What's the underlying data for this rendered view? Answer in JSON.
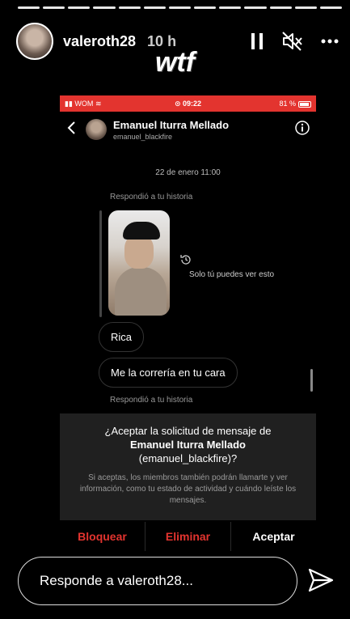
{
  "story": {
    "username": "valeroth28",
    "time": "10 h",
    "caption": "wtf",
    "segments_total": 13,
    "segments_done": 13
  },
  "screenshot": {
    "status": {
      "carrier": "WOM",
      "time": "09:22",
      "battery": "81 %"
    },
    "dm": {
      "name": "Emanuel Iturra Mellado",
      "handle": "emanuel_blackfire"
    },
    "date": "22 de enero 11:00",
    "replied_label": "Respondió a tu historia",
    "only_you": "Solo tú puedes ver esto",
    "messages": [
      "Rica",
      "Me la correría en tu cara"
    ],
    "request": {
      "line1": "¿Aceptar la solicitud de mensaje de",
      "name": "Emanuel Iturra Mellado",
      "handle_line": "(emanuel_blackfire)?",
      "note": "Si aceptas, los miembros también podrán llamarte y ver información, como tu estado de actividad y cuándo leíste los mensajes."
    },
    "actions": {
      "block": "Bloquear",
      "delete": "Eliminar",
      "accept": "Aceptar"
    }
  },
  "reply": {
    "placeholder": "Responde a valeroth28..."
  },
  "colors": {
    "accent_red": "#e3342f",
    "background": "#000000"
  }
}
